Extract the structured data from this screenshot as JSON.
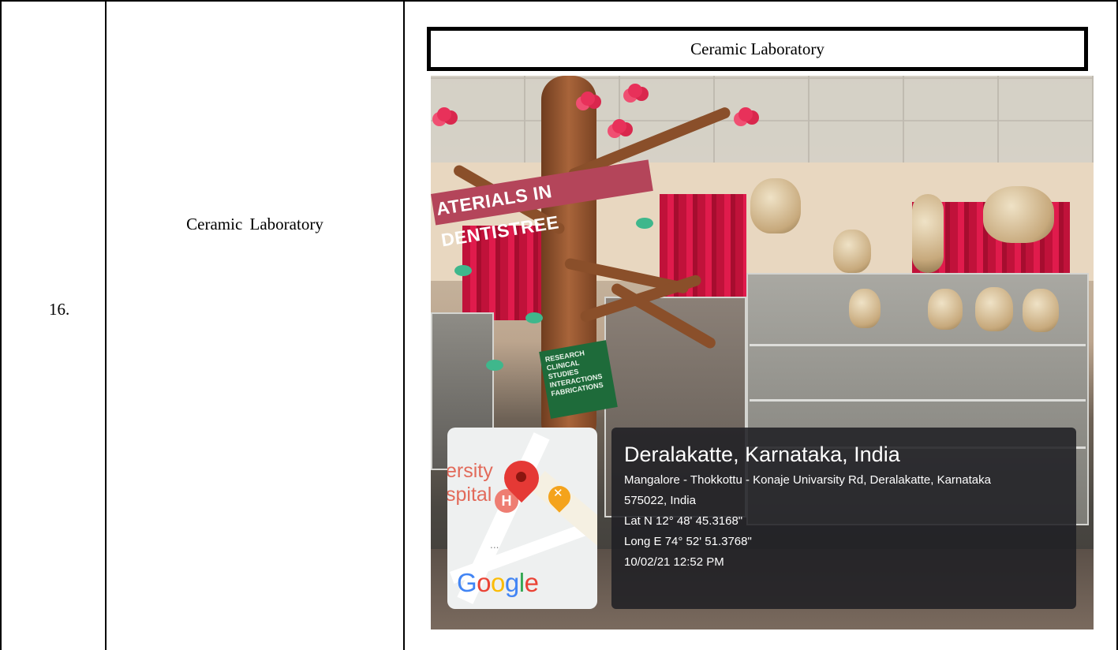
{
  "row": {
    "number": "16.",
    "name": "Ceramic  Laboratory"
  },
  "caption": "Ceramic Laboratory",
  "photo": {
    "banner_text": "ATERIALS IN DENTISTREE",
    "sign_lines": [
      "RESEARCH",
      "CLINICAL STUDIES",
      "INTERACTIONS",
      "FABRICATIONS"
    ],
    "map": {
      "label_line1": "ersity",
      "label_line2": "spital",
      "hospital_glyph": "H",
      "dots": "...",
      "logo": [
        "G",
        "o",
        "o",
        "g",
        "l",
        "e"
      ]
    },
    "geotag": {
      "place": "Deralakatte, Karnataka, India",
      "address_line1": "Mangalore - Thokkottu - Konaje Univarsity Rd, Deralakatte, Karnataka",
      "address_line2": "575022, India",
      "latitude": "Lat N 12° 48' 45.3168\"",
      "longitude": "Long E 74° 52' 51.3768\"",
      "timestamp": "10/02/21 12:52 PM"
    }
  },
  "colors": {
    "pin": "#e53935",
    "hospital_poi": "#ee7d72",
    "food_poi": "#f4a31c",
    "banner": "#b4455a",
    "sign": "#1e6b3a"
  }
}
